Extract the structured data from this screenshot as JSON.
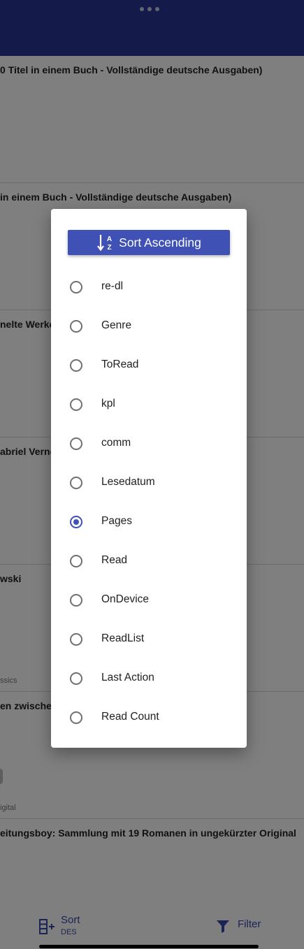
{
  "background": {
    "rows": [
      {
        "title": "0 Titel in einem Buch - Vollständige deutsche Ausgaben)",
        "subtitle": ""
      },
      {
        "title": "in einem Buch - Vollständige deutsche Ausgaben)",
        "subtitle": ""
      },
      {
        "title": "nelte Werke",
        "subtitle": ""
      },
      {
        "title": "abriel Verne",
        "subtitle": ""
      },
      {
        "title": "wski",
        "subtitle": "ssics"
      },
      {
        "title": "en zwischen",
        "subtitle": "igital"
      },
      {
        "title": "eitungsboy: Sammlung mit 19 Romanen in ungekürzter Original",
        "subtitle": ""
      }
    ]
  },
  "bottom_bar": {
    "sort_label": "Sort",
    "sort_sub": "DES",
    "filter_label": "Filter"
  },
  "dialog": {
    "header_label": "Sort Ascending",
    "selected": "Pages",
    "options": [
      "re-dl",
      "Genre",
      "ToRead",
      "kpl",
      "comm",
      "Lesedatum",
      "Pages",
      "Read",
      "OnDevice",
      "ReadList",
      "Last Action",
      "Read Count"
    ]
  },
  "colors": {
    "app_bar": "#283593",
    "accent": "#3f51b5",
    "scrim": "rgba(0,0,0,0.5)"
  },
  "icons": {
    "menu": "more-horizontal-icon",
    "sort_header": "sort-alpha-asc-icon",
    "sort": "sort-add-icon",
    "filter": "filter-funnel-icon"
  }
}
